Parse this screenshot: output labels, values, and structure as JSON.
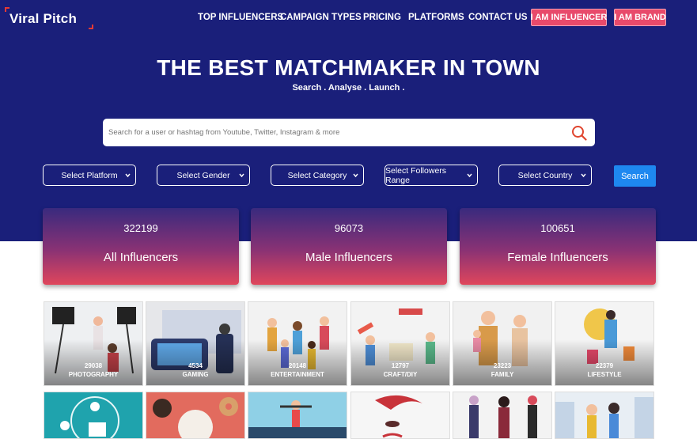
{
  "brand": {
    "name": "Viral Pitch"
  },
  "nav": {
    "links": [
      "TOP INFLUENCERS",
      "CAMPAIGN TYPES",
      "PRICING",
      "PLATFORMS",
      "CONTACT US"
    ],
    "influencer_btn": "I AM INFLUENCER",
    "brand_btn": "I AM BRAND"
  },
  "hero": {
    "title": "THE BEST MATCHMAKER IN TOWN",
    "subtitle": "Search . Analyse . Launch ."
  },
  "search": {
    "placeholder": "Search for a user or hashtag from Youtube, Twitter, Instagram & more",
    "icon": "search-icon"
  },
  "filters": {
    "platform": "Select Platform",
    "gender": "Select Gender",
    "category": "Select Category",
    "followers": "Select Followers Range",
    "country": "Select Country",
    "search_btn": "Search"
  },
  "stats": [
    {
      "count": "322199",
      "label": "All Influencers"
    },
    {
      "count": "96073",
      "label": "Male Influencers"
    },
    {
      "count": "100651",
      "label": "Female Influencers"
    }
  ],
  "categories": [
    {
      "count": "29038",
      "name": "PHOTOGRAPHY"
    },
    {
      "count": "4534",
      "name": "GAMING"
    },
    {
      "count": "20148",
      "name": "ENTERTAINMENT"
    },
    {
      "count": "12797",
      "name": "CRAFT/DIY"
    },
    {
      "count": "23223",
      "name": "FAMILY"
    },
    {
      "count": "22379",
      "name": "LIFESTYLE"
    }
  ],
  "colors": {
    "hero": "#1a1f7a",
    "accent": "#e84a6b",
    "search_button": "#1e88f0"
  }
}
